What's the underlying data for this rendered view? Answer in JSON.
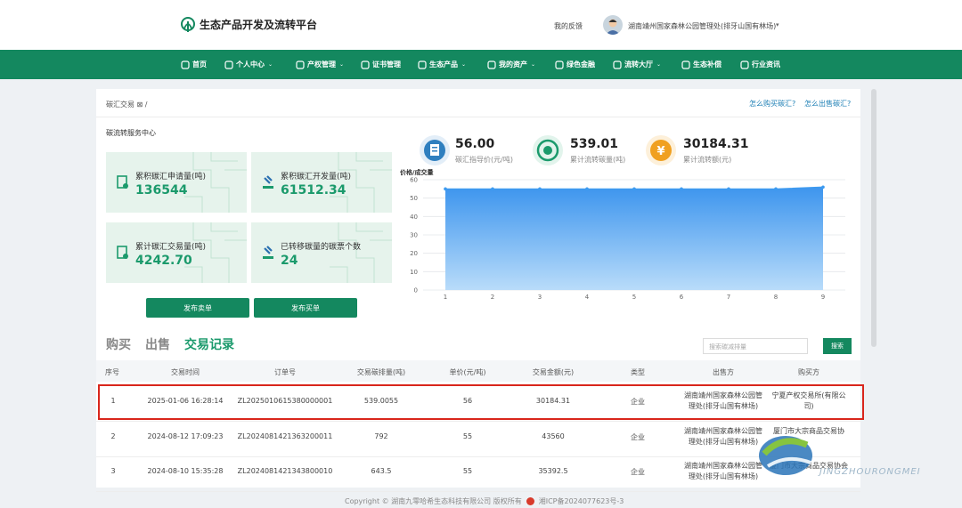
{
  "header": {
    "site_title": "生态产品开发及流转平台",
    "feedback": "我的反馈",
    "user_name": "湖南靖州国家森林公园管理处(排牙山国有林场)",
    "caret": "▾"
  },
  "nav": {
    "items": [
      {
        "label": "首页",
        "icon": "home-icon",
        "dropdown": false
      },
      {
        "label": "个人中心",
        "icon": "user-icon",
        "dropdown": true
      },
      {
        "label": "产权管理",
        "icon": "property-icon",
        "dropdown": true
      },
      {
        "label": "证书管理",
        "icon": "certificate-icon",
        "dropdown": false
      },
      {
        "label": "生态产品",
        "icon": "eco-product-icon",
        "dropdown": true
      },
      {
        "label": "我的资产",
        "icon": "asset-icon",
        "dropdown": true
      },
      {
        "label": "绿色金融",
        "icon": "finance-icon",
        "dropdown": false
      },
      {
        "label": "流转大厅",
        "icon": "hall-icon",
        "dropdown": true
      },
      {
        "label": "生态补偿",
        "icon": "compensation-icon",
        "dropdown": false
      },
      {
        "label": "行业资讯",
        "icon": "news-icon",
        "dropdown": false
      }
    ],
    "caret": "⌄"
  },
  "breadcrumb": {
    "text": "碳汇交易 ⊠ /"
  },
  "help_links": {
    "how_buy": "怎么购买碳汇?",
    "how_sell": "怎么出售碳汇?"
  },
  "service_center": {
    "title": "碳流转服务中心",
    "stats": [
      {
        "label": "累积碳汇申请量(吨)",
        "value": "136544"
      },
      {
        "label": "累积碳汇开发量(吨)",
        "value": "61512.34"
      },
      {
        "label": "累计碳汇交易量(吨)",
        "value": "4242.70"
      },
      {
        "label": "已转移碳量的碳票个数",
        "value": "24"
      }
    ],
    "buttons": {
      "sell": "发布卖单",
      "buy": "发布买单"
    }
  },
  "kpis": [
    {
      "value": "56.00",
      "label": "碳汇指导价(元/吨)",
      "color": "#2f7fbf"
    },
    {
      "value": "539.01",
      "label": "累计流转碳量(吨)",
      "color": "#1b9a6c"
    },
    {
      "value": "30184.31",
      "label": "累计流转额(元)",
      "color": "#f0a020"
    }
  ],
  "chart_data": {
    "type": "area",
    "ylabel": "价格/成交量",
    "x": [
      1,
      2,
      3,
      4,
      5,
      6,
      7,
      8,
      9
    ],
    "values": [
      55,
      55,
      55,
      55,
      55,
      55,
      55,
      55,
      56
    ],
    "ylim": [
      0,
      60
    ],
    "yticks": [
      0,
      10,
      20,
      30,
      40,
      50,
      60
    ],
    "grid": true,
    "color": "#3d9bf0"
  },
  "trade": {
    "tabs": [
      "购买",
      "出售",
      "交易记录"
    ],
    "active_tab": 2,
    "search_placeholder": "搜索碳减排量",
    "search_button": "搜索",
    "columns": [
      "序号",
      "交易时间",
      "订单号",
      "交易碳排量(吨)",
      "单价(元/吨)",
      "交易金额(元)",
      "类型",
      "出售方",
      "购买方"
    ],
    "rows": [
      [
        "1",
        "2025-01-06 16:28:14",
        "ZL2025010615380000001",
        "539.0055",
        "56",
        "30184.31",
        "企业",
        "湖南靖州国家森林公园管理处(排牙山国有林场)",
        "宁夏产权交易所(有限公司)"
      ],
      [
        "2",
        "2024-08-12 17:09:23",
        "ZL2024081421363200011",
        "792",
        "55",
        "43560",
        "企业",
        "湖南靖州国家森林公园管理处(排牙山国有林场)",
        "厦门市大宗商品交易协"
      ],
      [
        "3",
        "2024-08-10 15:35:28",
        "ZL2024081421343800010",
        "643.5",
        "55",
        "35392.5",
        "企业",
        "湖南靖州国家森林公园管理处(排牙山国有林场)",
        "厦门市大宗商品交易协会"
      ]
    ]
  },
  "footer": {
    "copyright": "Copyright © 湖南九零哈希生态科技有限公司 版权所有",
    "icp": "湘ICP备2024077623号-3"
  },
  "watermark": {
    "text": "JINGZHOURONGMEI"
  }
}
